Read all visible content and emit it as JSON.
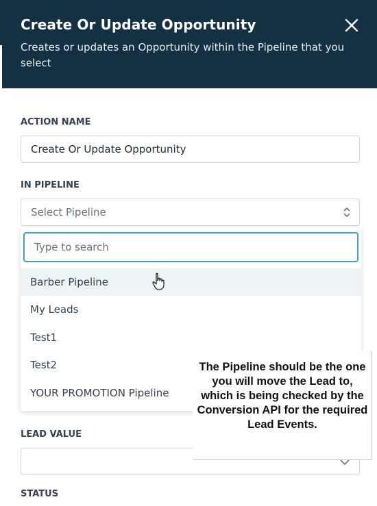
{
  "header": {
    "title": "Create Or Update Opportunity",
    "subtitle": "Creates or updates an Opportunity within the Pipeline that you select",
    "close_icon": "close-icon"
  },
  "form": {
    "action_name_label": "ACTION NAME",
    "action_name_value": "Create Or Update Opportunity",
    "in_pipeline_label": "IN PIPELINE",
    "pipeline_placeholder": "Select Pipeline",
    "search_placeholder": "Type to search",
    "pipeline_options": [
      "Barber Pipeline",
      "My Leads",
      "Test1",
      "Test2",
      "YOUR PROMOTION Pipeline"
    ],
    "lead_value_label": "LEAD VALUE",
    "status_label": "STATUS"
  },
  "callout": {
    "text": "The Pipeline should be the one you will move the Lead to, which is being checked by the Conversion API for the required Lead Events."
  },
  "colors": {
    "header_bg": "#143144",
    "focus_border": "#3aa3d8",
    "hover_bg": "#eef3f6"
  }
}
